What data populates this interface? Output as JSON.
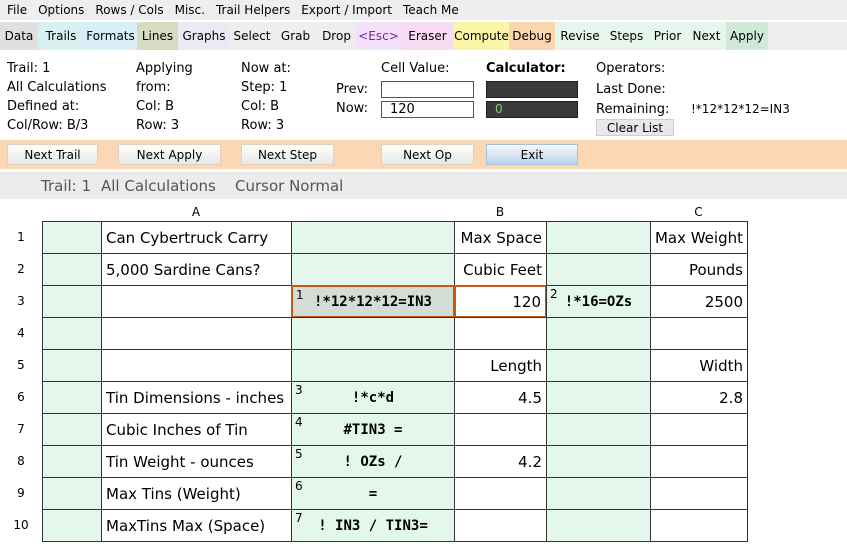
{
  "menu": [
    "File",
    "Options",
    "Rows / Cols",
    "Misc.",
    "Trail Helpers",
    "Export / Import",
    "Teach Me"
  ],
  "toolbar": [
    {
      "label": "Data",
      "bg": "#e0e0e0"
    },
    {
      "label": "Trails",
      "bg": "#d8f0f0"
    },
    {
      "label": "Formats",
      "bg": "#d8eef8"
    },
    {
      "label": "Lines",
      "bg": "#d6dcc2"
    },
    {
      "label": "Graphs",
      "bg": "#ece8f4"
    },
    {
      "label": "Select",
      "bg": "#eeeeee"
    },
    {
      "label": "Grab",
      "bg": "#eeeeee"
    },
    {
      "label": "Drop",
      "bg": "#eeeeee"
    },
    {
      "label": "<Esc>",
      "bg": "#f4e0f8",
      "color": "#7a1fa8"
    },
    {
      "label": "Eraser",
      "bg": "#f6dcf2"
    },
    {
      "label": "Compute",
      "bg": "#fbf7a6"
    },
    {
      "label": "Debug",
      "bg": "#f9d5b0"
    },
    {
      "label": "Revise",
      "bg": "#e7f6ec"
    },
    {
      "label": "Steps",
      "bg": "#e7f6ec"
    },
    {
      "label": "Prior",
      "bg": "#e7f6ec"
    },
    {
      "label": "Next",
      "bg": "#e7f6ec"
    },
    {
      "label": "Apply",
      "bg": "#cfe8d8"
    }
  ],
  "info": {
    "trail": "Trail: 1",
    "all_calc": "All Calculations",
    "defined_at": "Defined at:",
    "colrow": "Col/Row: B/3",
    "applying": "Applying",
    "from": "from:",
    "col": "Col: B",
    "row": "Row: 3",
    "now_at": "Now at:",
    "step": "Step: 1",
    "col2": "Col: B",
    "row2": "Row: 3",
    "prev_label": "Prev:",
    "now_label": "Now:",
    "cell_value_label": "Cell Value:",
    "prev_value": "",
    "now_value": "120",
    "calculator_label": "Calculator:",
    "calc_top": "",
    "calc_bottom": "0",
    "operators_label": "Operators:",
    "last_done_label": "Last Done:",
    "remaining_label": "Remaining:",
    "remaining_value": "!*12*12*12=IN3",
    "clear_list": "Clear List"
  },
  "buttons": {
    "next_trail": "Next Trail",
    "next_apply": "Next Apply",
    "next_step": "Next Step",
    "next_op": "Next Op",
    "exit": "Exit"
  },
  "status": {
    "trail": "Trail: 1",
    "calcs": "All Calculations",
    "cursor": "Cursor Normal"
  },
  "sheet": {
    "col_headers": [
      "A",
      "B",
      "C"
    ],
    "row_numbers": [
      "1",
      "2",
      "3",
      "4",
      "5",
      "6",
      "7",
      "8",
      "9",
      "10"
    ],
    "rows": [
      [
        "",
        "Can Cybertruck Carry",
        "",
        "Max Space",
        "",
        "Max Weight"
      ],
      [
        "",
        "5,000 Sardine Cans?",
        "",
        "Cubic Feet",
        "",
        "Pounds"
      ],
      [
        "",
        "",
        "!*12*12*12=IN3",
        "120",
        "!*16=OZs",
        "2500"
      ],
      [
        "",
        "",
        "",
        "",
        "",
        ""
      ],
      [
        "",
        "",
        "",
        "Length",
        "",
        "Width"
      ],
      [
        "",
        "Tin Dimensions - inches",
        "!*c*d",
        "4.5",
        "",
        "2.8"
      ],
      [
        "",
        "Cubic Inches of Tin",
        "#TIN3 =",
        "",
        "",
        ""
      ],
      [
        "",
        "Tin Weight - ounces",
        "! OZs /",
        "4.2",
        "",
        ""
      ],
      [
        "",
        "Max Tins (Weight)",
        "=",
        "",
        "",
        ""
      ],
      [
        "",
        "MaxTins Max (Space)",
        "! IN3 / TIN3=",
        "",
        "",
        ""
      ]
    ],
    "formula_tags": {
      "2": [
        "1",
        "2"
      ],
      "5": [
        "3"
      ],
      "6": [
        "4"
      ],
      "7": [
        "5"
      ],
      "8": [
        "6"
      ],
      "9": [
        "7"
      ]
    },
    "highlight_color": "#c25a10"
  }
}
